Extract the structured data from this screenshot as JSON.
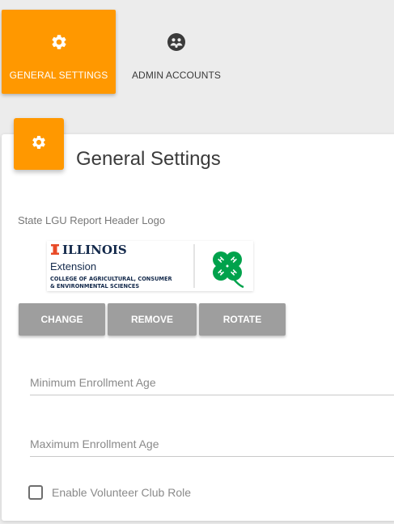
{
  "tabs": [
    {
      "label": "GENERAL SETTINGS",
      "icon": "gear-icon",
      "active": true
    },
    {
      "label": "ADMIN ACCOUNTS",
      "icon": "group-icon",
      "active": false
    }
  ],
  "card": {
    "icon": "gear-icon",
    "title": "General Settings",
    "logo_label": "State LGU Report Header Logo",
    "logo": {
      "mark": "I",
      "name": "ILLINOIS",
      "sub": "Extension",
      "line1": "COLLEGE OF AGRICULTURAL, CONSUMER",
      "line2": "& ENVIRONMENTAL SCIENCES",
      "clover_letter": "H"
    },
    "buttons": {
      "change": "CHANGE",
      "remove": "REMOVE",
      "rotate": "ROTATE"
    },
    "fields": {
      "min_age_placeholder": "Minimum Enrollment Age",
      "max_age_placeholder": "Maximum Enrollment Age"
    },
    "checkbox": {
      "label": "Enable Volunteer Club Role",
      "checked": false
    }
  },
  "colors": {
    "accent": "#ff9800",
    "button_gray": "#9e9e9e",
    "illinois_orange": "#e84a27",
    "illinois_blue": "#13294b",
    "clover_green": "#00a24c"
  }
}
